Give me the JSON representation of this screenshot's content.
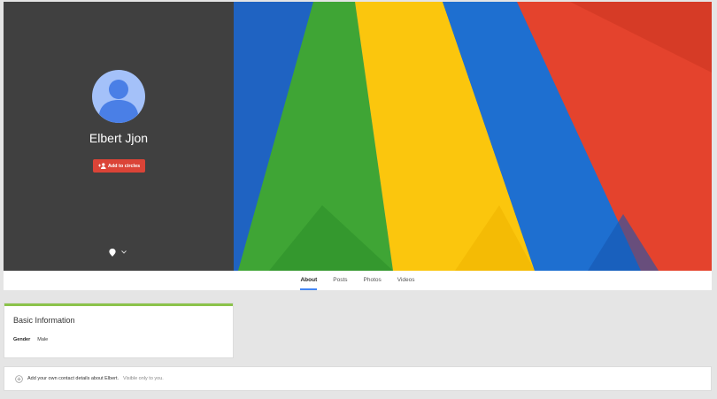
{
  "profile": {
    "name": "Elbert Jjon",
    "add_to_circles_label": "Add to circles"
  },
  "tabs": [
    {
      "label": "About",
      "active": true
    },
    {
      "label": "Posts",
      "active": false
    },
    {
      "label": "Photos",
      "active": false
    },
    {
      "label": "Videos",
      "active": false
    }
  ],
  "basic_info": {
    "title": "Basic Information",
    "gender_label": "Gender",
    "gender_value": "Male"
  },
  "contact": {
    "text": "Add your own contact details about Elbert.",
    "note": "Visible only to you."
  },
  "colors": {
    "profile_panel": "#404040",
    "avatar_bg": "#a4c1f9",
    "avatar_figure": "#4a7fe6",
    "add_button": "#db4437",
    "active_tab_underline": "#4285f4",
    "basic_info_accent": "#8bc34a",
    "cover_green": "#3fa535",
    "cover_yellow": "#fbc60d",
    "cover_blue": "#1e6fd0",
    "cover_red": "#e4432d"
  },
  "icons": {
    "avatar": "default-person-avatar",
    "add_to_circles": "person-add-icon",
    "pin": "location-pin-icon",
    "dropdown": "chevron-down-icon",
    "add_contact": "plus-circle-icon"
  }
}
